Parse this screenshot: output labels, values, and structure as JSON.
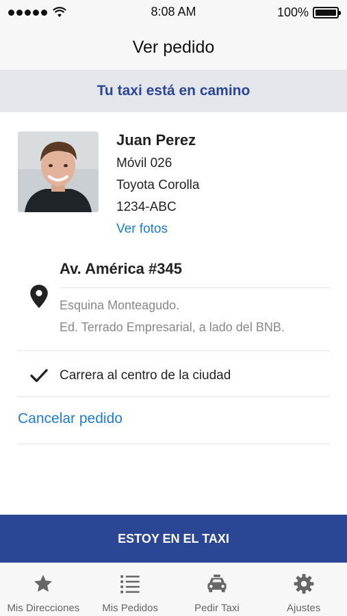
{
  "status_bar": {
    "time": "8:08 AM",
    "battery": "100%"
  },
  "nav": {
    "title": "Ver pedido"
  },
  "banner": {
    "text": "Tu taxi está en camino"
  },
  "driver": {
    "name": "Juan Perez",
    "unit": "Móvil 026",
    "car": "Toyota Corolla",
    "plate": "1234-ABC",
    "photos_link": "Ver fotos"
  },
  "address": {
    "title": "Av. América #345",
    "line1": "Esquina Monteagudo.",
    "line2": "Ed. Terrado Empresarial, a lado del BNB."
  },
  "note": {
    "text": "Carrera al centro de la ciudad"
  },
  "actions": {
    "cancel": "Cancelar pedido",
    "confirm": "ESTOY EN EL TAXI"
  },
  "tabs": [
    {
      "label": "Mis Direcciones",
      "icon": "star-icon"
    },
    {
      "label": "Mis Pedidos",
      "icon": "list-icon"
    },
    {
      "label": "Pedir Taxi",
      "icon": "car-icon"
    },
    {
      "label": "Ajustes",
      "icon": "gear-icon"
    }
  ],
  "colors": {
    "brand": "#2b4694",
    "link": "#1e7bd3",
    "banner_bg": "#e4e6eb"
  }
}
